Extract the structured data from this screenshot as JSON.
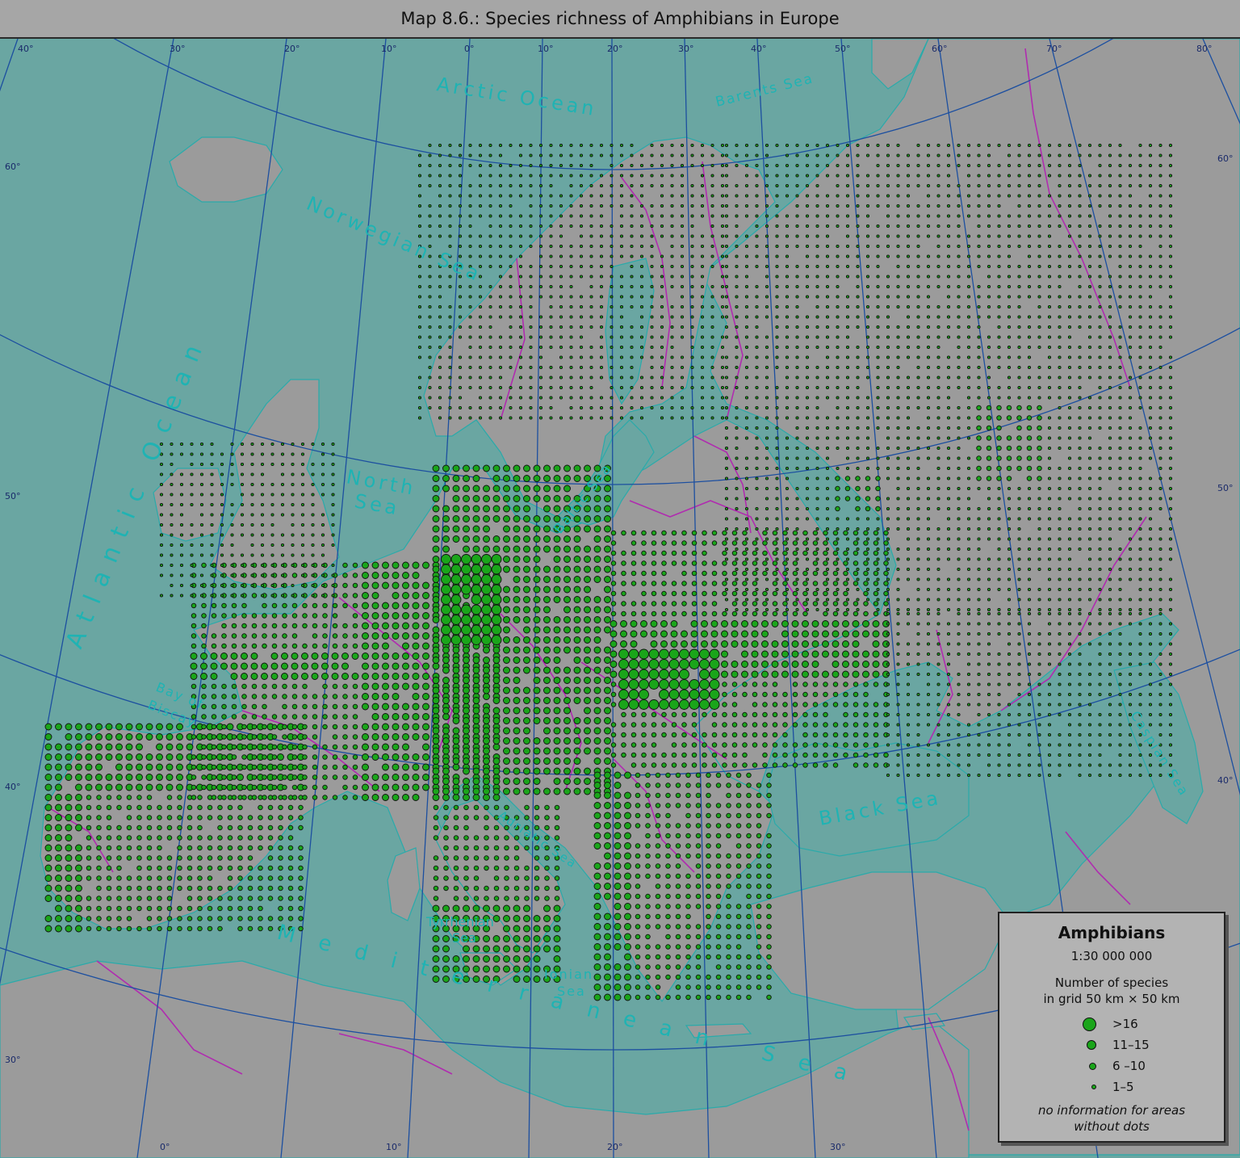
{
  "title": "Map 8.6.: Species richness of Amphibians in Europe",
  "colors": {
    "sea": "#6aa6a2",
    "land": "#9b9b9b",
    "dot_fill": "#1aa51a",
    "graticule": "#1c4fa0",
    "border": "#b02cb0",
    "label": "#1fb3b3"
  },
  "sea_labels": [
    "Arctic Ocean",
    "Barents Sea",
    "Norwegian Sea",
    "Atlantic Ocean",
    "North",
    "Sea",
    "Baltic Sea",
    "Bay of",
    "Biscay",
    "Adriatic Sea",
    "Tyrrhenian",
    "Sea",
    "Ionian",
    "Sea",
    "Black Sea",
    "Caspian Sea",
    "Mediterranean Sea"
  ],
  "graticule_labels": {
    "top": [
      "40°",
      "30°",
      "20°",
      "10°",
      "0°",
      "10°",
      "20°",
      "30°",
      "40°",
      "50°",
      "60°",
      "70°",
      "80°"
    ],
    "left": [
      "60°",
      "50°",
      "40°",
      "30°"
    ],
    "right": [
      "60°",
      "50°",
      "40°"
    ],
    "bottom": [
      "0°",
      "10°",
      "20°",
      "30°"
    ]
  },
  "legend": {
    "title": "Amphibians",
    "scale": "1:30 000 000",
    "description_line1": "Number of species",
    "description_line2": "in grid 50 km × 50 km",
    "classes": [
      {
        "label": ">16",
        "symbol": "dot-large"
      },
      {
        "label": "11–15",
        "symbol": "dot-medium"
      },
      {
        "label": "6 –10",
        "symbol": "dot-small"
      },
      {
        "label": "1–5",
        "symbol": "dot-tiny"
      }
    ],
    "note_line1": "no information for areas",
    "note_line2": "without dots"
  }
}
